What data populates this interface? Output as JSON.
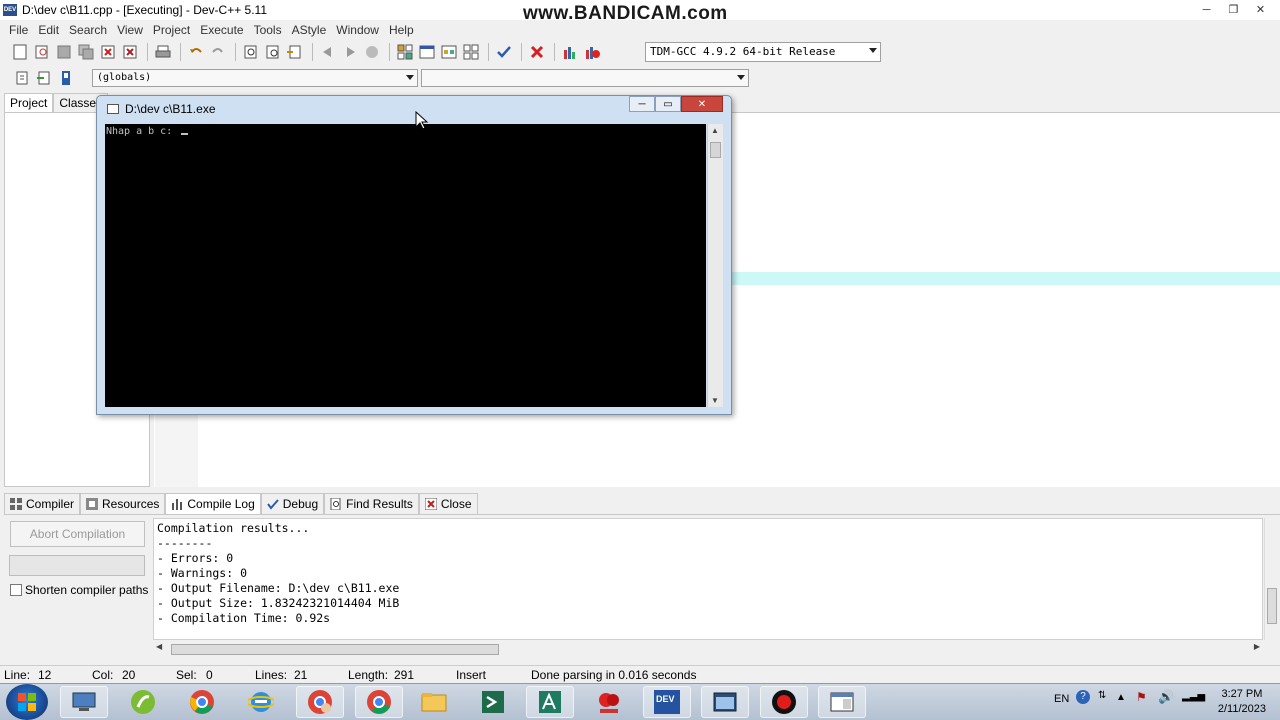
{
  "window": {
    "title": "D:\\dev c\\B11.cpp - [Executing] - Dev-C++ 5.11",
    "app_icon_text": "DEV",
    "controls": [
      "─",
      "❐",
      "✕"
    ]
  },
  "watermark": "www.BANDICAM.com",
  "menu": [
    "File",
    "Edit",
    "Search",
    "View",
    "Project",
    "Execute",
    "Tools",
    "AStyle",
    "Window",
    "Help"
  ],
  "toolbar": {
    "compiler_select": "TDM-GCC 4.9.2 64-bit Release",
    "globals_select": "(globals)",
    "members_select": ""
  },
  "left_tabs": [
    "Project",
    "Classes"
  ],
  "console": {
    "title": "D:\\dev c\\B11.exe",
    "output": "Nhap a b c: "
  },
  "bottom_tabs": [
    {
      "label": "Compiler",
      "icon": "grid-icon"
    },
    {
      "label": "Resources",
      "icon": "resources-icon"
    },
    {
      "label": "Compile Log",
      "icon": "chart-icon"
    },
    {
      "label": "Debug",
      "icon": "check-icon"
    },
    {
      "label": "Find Results",
      "icon": "find-icon"
    },
    {
      "label": "Close",
      "icon": "close-icon"
    }
  ],
  "compile_panel": {
    "abort_label": "Abort Compilation",
    "shorten_label": "Shorten compiler paths",
    "log_lines": [
      "Compilation results...",
      "--------",
      "- Errors: 0",
      "- Warnings: 0",
      "- Output Filename: D:\\dev c\\B11.exe",
      "- Output Size: 1.83242321014404 MiB",
      "- Compilation Time: 0.92s"
    ]
  },
  "status": {
    "line_label": "Line:",
    "line_value": "12",
    "col_label": "Col:",
    "col_value": "20",
    "sel_label": "Sel:",
    "sel_value": "0",
    "lines_label": "Lines:",
    "lines_value": "21",
    "length_label": "Length:",
    "length_value": "291",
    "mode": "Insert",
    "message": "Done parsing in 0.016 seconds"
  },
  "taskbar": {
    "lang": "EN",
    "time": "3:27 PM",
    "date": "2/11/2023",
    "dev_label": "DEV"
  }
}
